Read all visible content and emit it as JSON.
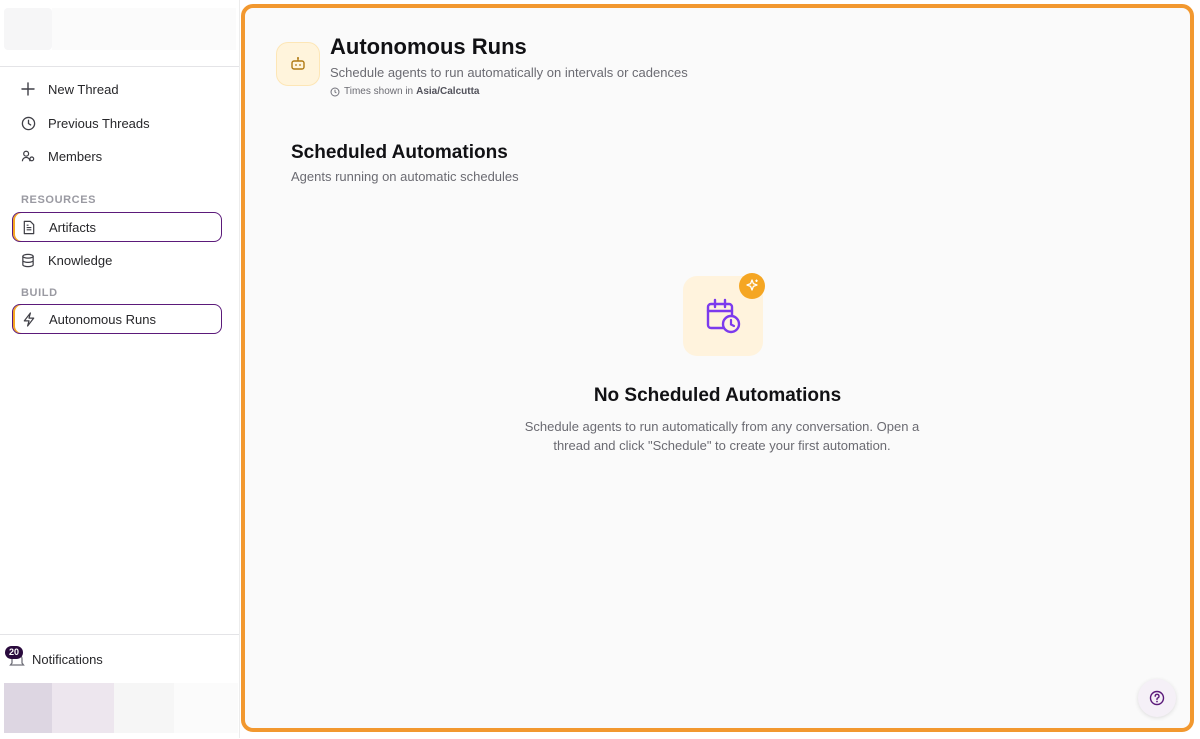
{
  "sidebar": {
    "nav": [
      {
        "label": "New Thread",
        "icon": "plus-icon"
      },
      {
        "label": "Previous Threads",
        "icon": "clock-icon"
      },
      {
        "label": "Members",
        "icon": "members-icon"
      }
    ],
    "resources_label": "RESOURCES",
    "resources": [
      {
        "label": "Artifacts",
        "icon": "document-icon",
        "active": true
      },
      {
        "label": "Knowledge",
        "icon": "database-icon"
      }
    ],
    "build_label": "BUILD",
    "build": [
      {
        "label": "Autonomous Runs",
        "icon": "lightning-icon",
        "active": true
      }
    ],
    "notifications": {
      "label": "Notifications",
      "count": "20"
    }
  },
  "header": {
    "title": "Autonomous Runs",
    "subtitle": "Schedule agents to run automatically on intervals or cadences",
    "tz_prefix": "Times shown in",
    "tz_value": "Asia/Calcutta"
  },
  "section": {
    "title": "Scheduled Automations",
    "subtitle": "Agents running on automatic schedules"
  },
  "empty_state": {
    "title": "No Scheduled Automations",
    "description": "Schedule agents to run automatically from any conversation. Open a thread and click \"Schedule\" to create your first automation."
  },
  "colors": {
    "accent_border": "#f2982f",
    "active_item_border": "#5b1a7a",
    "icon_purple": "#7c3aed",
    "sparkle": "#f5a623"
  }
}
